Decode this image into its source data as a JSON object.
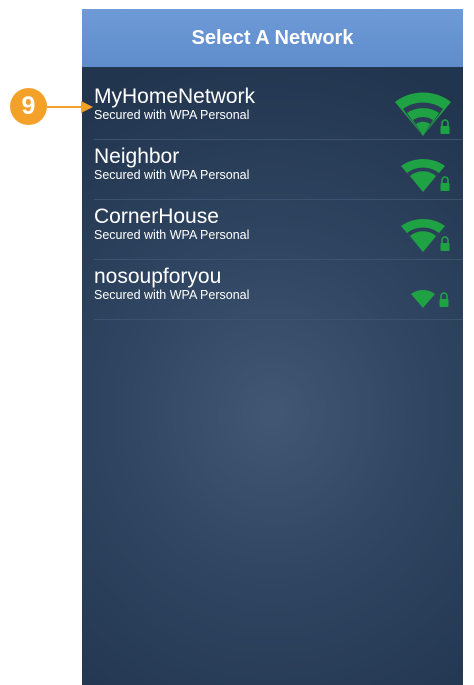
{
  "header": {
    "title": "Select A Network"
  },
  "callout": {
    "number": "9"
  },
  "networks": [
    {
      "name": "MyHomeNetwork",
      "security": "Secured with WPA Personal",
      "signal_bars": 3
    },
    {
      "name": "Neighbor",
      "security": "Secured with WPA Personal",
      "signal_bars": 2
    },
    {
      "name": "CornerHouse",
      "security": "Secured with WPA Personal",
      "signal_bars": 2
    },
    {
      "name": "nosoupforyou",
      "security": "Secured with WPA Personal",
      "signal_bars": 1
    }
  ],
  "colors": {
    "header_bg": "#6e9ad8",
    "signal": "#1fa244",
    "callout": "#f4a12a"
  },
  "icons": {
    "signal": "wifi-signal-icon",
    "lock": "lock-icon"
  }
}
